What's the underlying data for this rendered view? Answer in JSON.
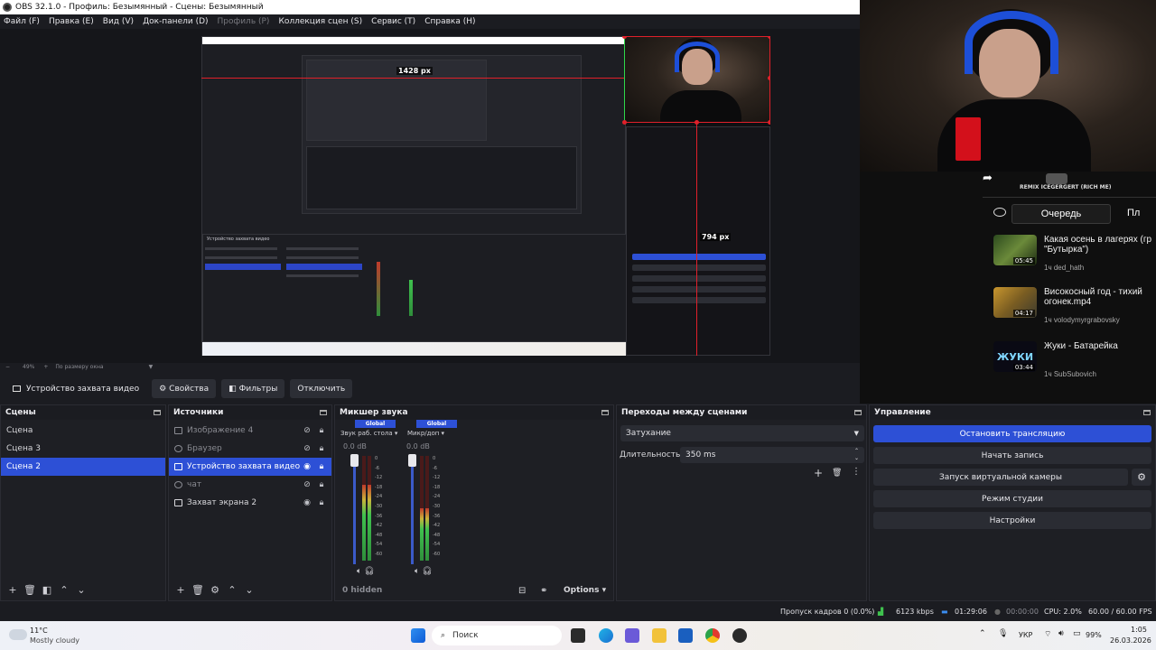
{
  "window": {
    "title": "OBS 32.1.0 - Профиль: Безымянный - Сцены: Безымянный"
  },
  "menu": [
    {
      "label": "Файл (F)",
      "enabled": true
    },
    {
      "label": "Правка (E)",
      "enabled": true
    },
    {
      "label": "Вид (V)",
      "enabled": true
    },
    {
      "label": "Док-панели (D)",
      "enabled": true
    },
    {
      "label": "Профиль (P)",
      "enabled": false
    },
    {
      "label": "Коллекция сцен (S)",
      "enabled": true
    },
    {
      "label": "Сервис (T)",
      "enabled": true
    },
    {
      "label": "Справка (H)",
      "enabled": true
    }
  ],
  "preview": {
    "width_label": "1428 px",
    "height_label": "794 px",
    "zoom": "49%",
    "zoom_mode": "По размеру окна"
  },
  "source_toolbar": {
    "device": "Устройство захвата видео",
    "properties": "Свойства",
    "filters": "Фильтры",
    "deactivate": "Отключить"
  },
  "scenes": {
    "title": "Сцены",
    "items": [
      "Сцена",
      "Сцена 3",
      "Сцена 2"
    ],
    "selected_index": 2
  },
  "sources": {
    "title": "Источники",
    "items": [
      {
        "label": "Изображение 4",
        "visible": false,
        "icon": "image-icon"
      },
      {
        "label": "Браузер",
        "visible": false,
        "icon": "globe-icon"
      },
      {
        "label": "Устройство захвата видео",
        "visible": true,
        "icon": "camera-icon",
        "selected": true
      },
      {
        "label": "чат",
        "visible": false,
        "icon": "globe-icon"
      },
      {
        "label": "Захват экрана 2",
        "visible": true,
        "icon": "monitor-icon"
      }
    ]
  },
  "mixer": {
    "title": "Микшер звука",
    "channels": [
      {
        "tag": "Global",
        "name": "Звук раб. стола",
        "db": "0.0 dB",
        "level": 0.72
      },
      {
        "tag": "Global",
        "name": "Микр/доп",
        "db": "0.0 dB",
        "level": 0.5
      }
    ],
    "scale": [
      "0",
      "-6",
      "-12",
      "-18",
      "-24",
      "-30",
      "-36",
      "-42",
      "-48",
      "-54",
      "-60"
    ],
    "hidden": "0 hidden",
    "options": "Options"
  },
  "transitions": {
    "title": "Переходы между сценами",
    "type": "Затухание",
    "duration_label": "Длительность",
    "duration": "350 ms"
  },
  "controls": {
    "title": "Управление",
    "stop_stream": "Остановить трансляцию",
    "start_record": "Начать запись",
    "virtual_cam": "Запуск виртуальной камеры",
    "studio_mode": "Режим студии",
    "settings": "Настройки"
  },
  "status": {
    "dropped": "Пропуск кадров 0 (0.0%)",
    "bitrate": "6123 kbps",
    "stream_time": "01:29:06",
    "rec_time": "00:00:00",
    "cpu": "CPU: 2.0%",
    "fps": "60.00 / 60.00 FPS"
  },
  "youtube": {
    "channel_label": "REMIX ICEGERGERT (RICH ME)",
    "queue_tab": "Очередь",
    "next_tab": "Пл",
    "queue": [
      {
        "title": "Какая осень в лагерях (гр \"Бутырка\")",
        "duration": "05:45",
        "channel": "1ч   ded_hath"
      },
      {
        "title": "Високосный год - тихий огонек.mp4",
        "duration": "04:17",
        "channel": "1ч   volodymyrgrabovsky"
      },
      {
        "title": "Жуки - Батарейка",
        "duration": "03:44",
        "channel": "1ч   SubSubovich",
        "thumb_text": "ЖУКИ"
      }
    ]
  },
  "taskbar": {
    "weather_temp": "11°C",
    "weather_desc": "Mostly cloudy",
    "search": "Поиск",
    "lang": "УКР",
    "battery": "99%",
    "time": "1:05",
    "date": "26.03.2026"
  },
  "colors": {
    "accent": "#2d50d6",
    "bg": "#1e1f24",
    "live": "#e0202a"
  }
}
